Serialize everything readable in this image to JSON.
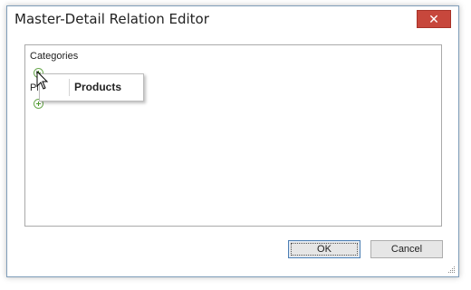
{
  "window": {
    "title": "Master-Detail Relation Editor",
    "close_glyph": "✕"
  },
  "designer": {
    "root_label": "Categories",
    "child_label_partial": "Pr",
    "popup_item": "Products"
  },
  "buttons": {
    "ok": "OK",
    "cancel": "Cancel"
  },
  "colors": {
    "close_button": "#c7473c",
    "plus_icon": "#6aa84f"
  }
}
